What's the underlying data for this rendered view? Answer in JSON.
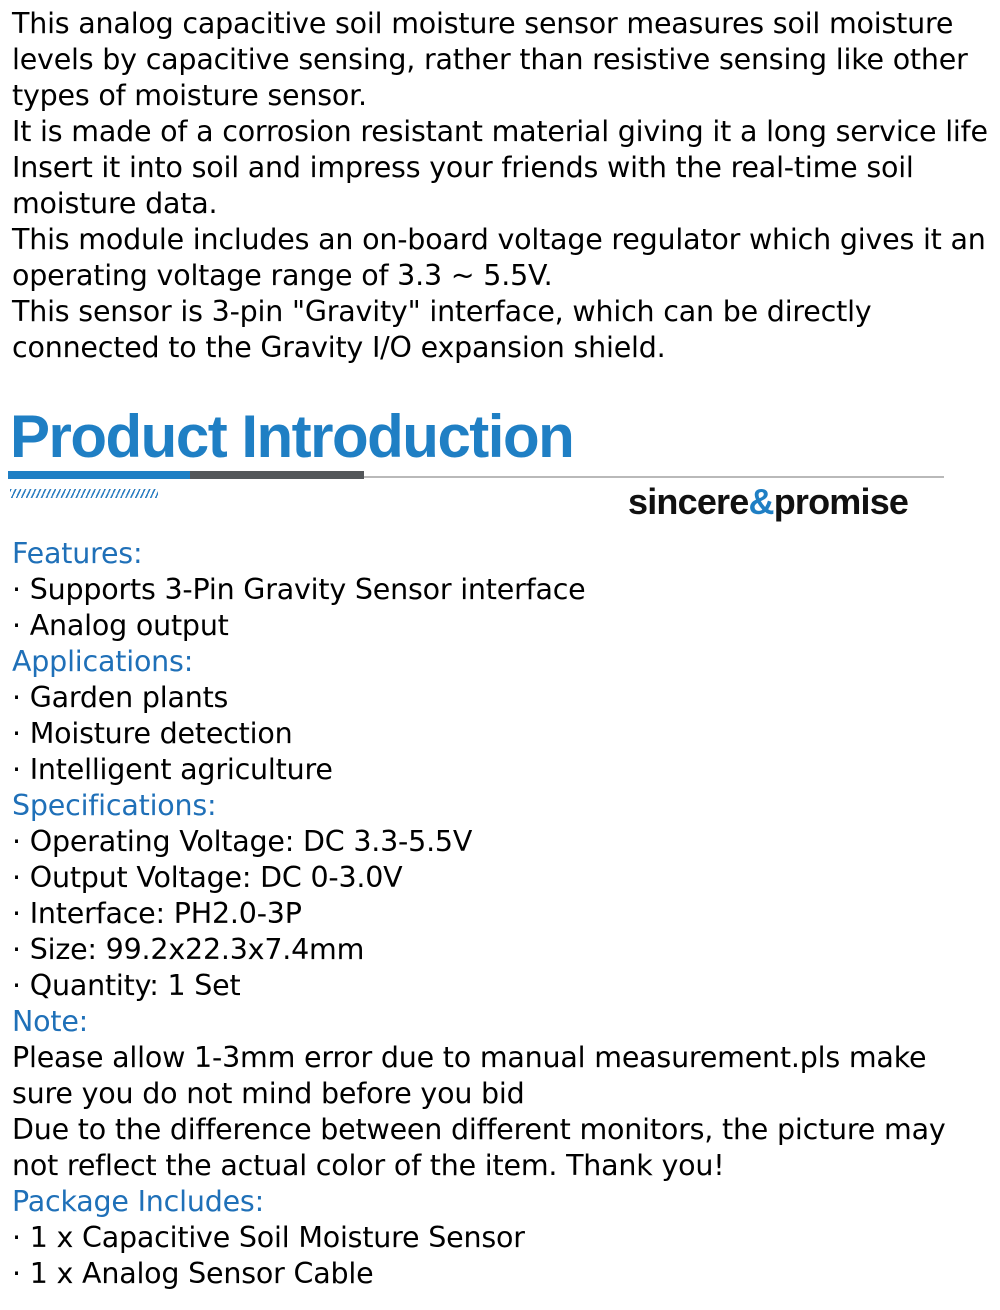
{
  "intro": {
    "lines": [
      "This analog capacitive soil moisture sensor measures soil moisture levels by capacitive sensing, rather than resistive sensing like other types of moisture sensor.",
      "It is made of a corrosion resistant material giving it a long service life",
      "Insert it into soil and impress your friends with the real-time soil moisture data.",
      "This module includes an on-board voltage regulator which gives it an operating voltage range of 3.3 ~ 5.5V.",
      "This sensor is 3-pin \"Gravity\" interface, which can be directly connected to the Gravity I/O expansion shield."
    ]
  },
  "banner": {
    "title": "Product Introduction",
    "brand_prefix": "sincere",
    "brand_amp": "&",
    "brand_suffix": "promise",
    "accent_color": "#1f7fc4"
  },
  "features": {
    "heading": "Features:",
    "items": [
      "· Supports 3-Pin Gravity Sensor interface",
      "· Analog output"
    ]
  },
  "applications": {
    "heading": "Applications:",
    "items": [
      "· Garden plants",
      "· Moisture detection",
      "· Intelligent agriculture"
    ]
  },
  "specifications": {
    "heading": "Specifications:",
    "items": [
      "· Operating Voltage: DC 3.3-5.5V",
      "· Output Voltage: DC 0-3.0V",
      "· Interface: PH2.0-3P",
      "· Size: 99.2x22.3x7.4mm",
      "· Quantity: 1 Set"
    ]
  },
  "note": {
    "heading": "Note:",
    "paragraphs": [
      "Please allow 1-3mm error due to manual measurement.pls make sure you do not mind before you bid",
      "Due to the difference between different monitors, the picture may not reflect the actual color of the item. Thank you!"
    ]
  },
  "package": {
    "heading": "Package Includes:",
    "items": [
      "· 1 x Capacitive Soil Moisture Sensor",
      "· 1 x Analog Sensor Cable"
    ]
  }
}
